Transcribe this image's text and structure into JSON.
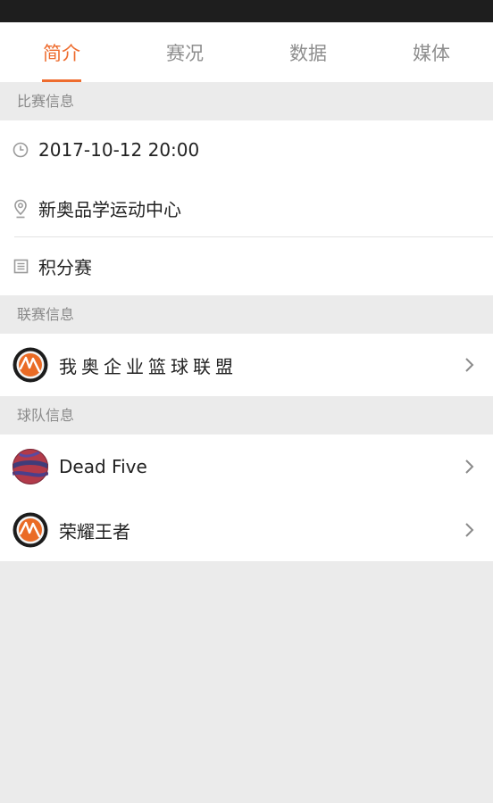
{
  "tabs": [
    {
      "label": "简介",
      "active": true
    },
    {
      "label": "赛况",
      "active": false
    },
    {
      "label": "数据",
      "active": false
    },
    {
      "label": "媒体",
      "active": false
    }
  ],
  "match_info": {
    "header": "比赛信息",
    "datetime": "2017-10-12 20:00",
    "venue": "新奥品学运动中心",
    "type": "积分赛",
    "icons": [
      "clock-icon",
      "location-pin-icon",
      "list-icon"
    ]
  },
  "league_info": {
    "header": "联赛信息",
    "name": "我奥企业篮球联盟",
    "logo_icon": "basketball-logo-icon"
  },
  "team_info": {
    "header": "球队信息",
    "teams": [
      {
        "name": "Dead Five",
        "logo_icon": "red-ball-logo-icon"
      },
      {
        "name": "荣耀王者",
        "logo_icon": "basketball-logo-icon"
      }
    ]
  },
  "colors": {
    "accent": "#ee6c2e",
    "inactive_tab": "#8e8e8e",
    "background": "#ebebeb"
  }
}
